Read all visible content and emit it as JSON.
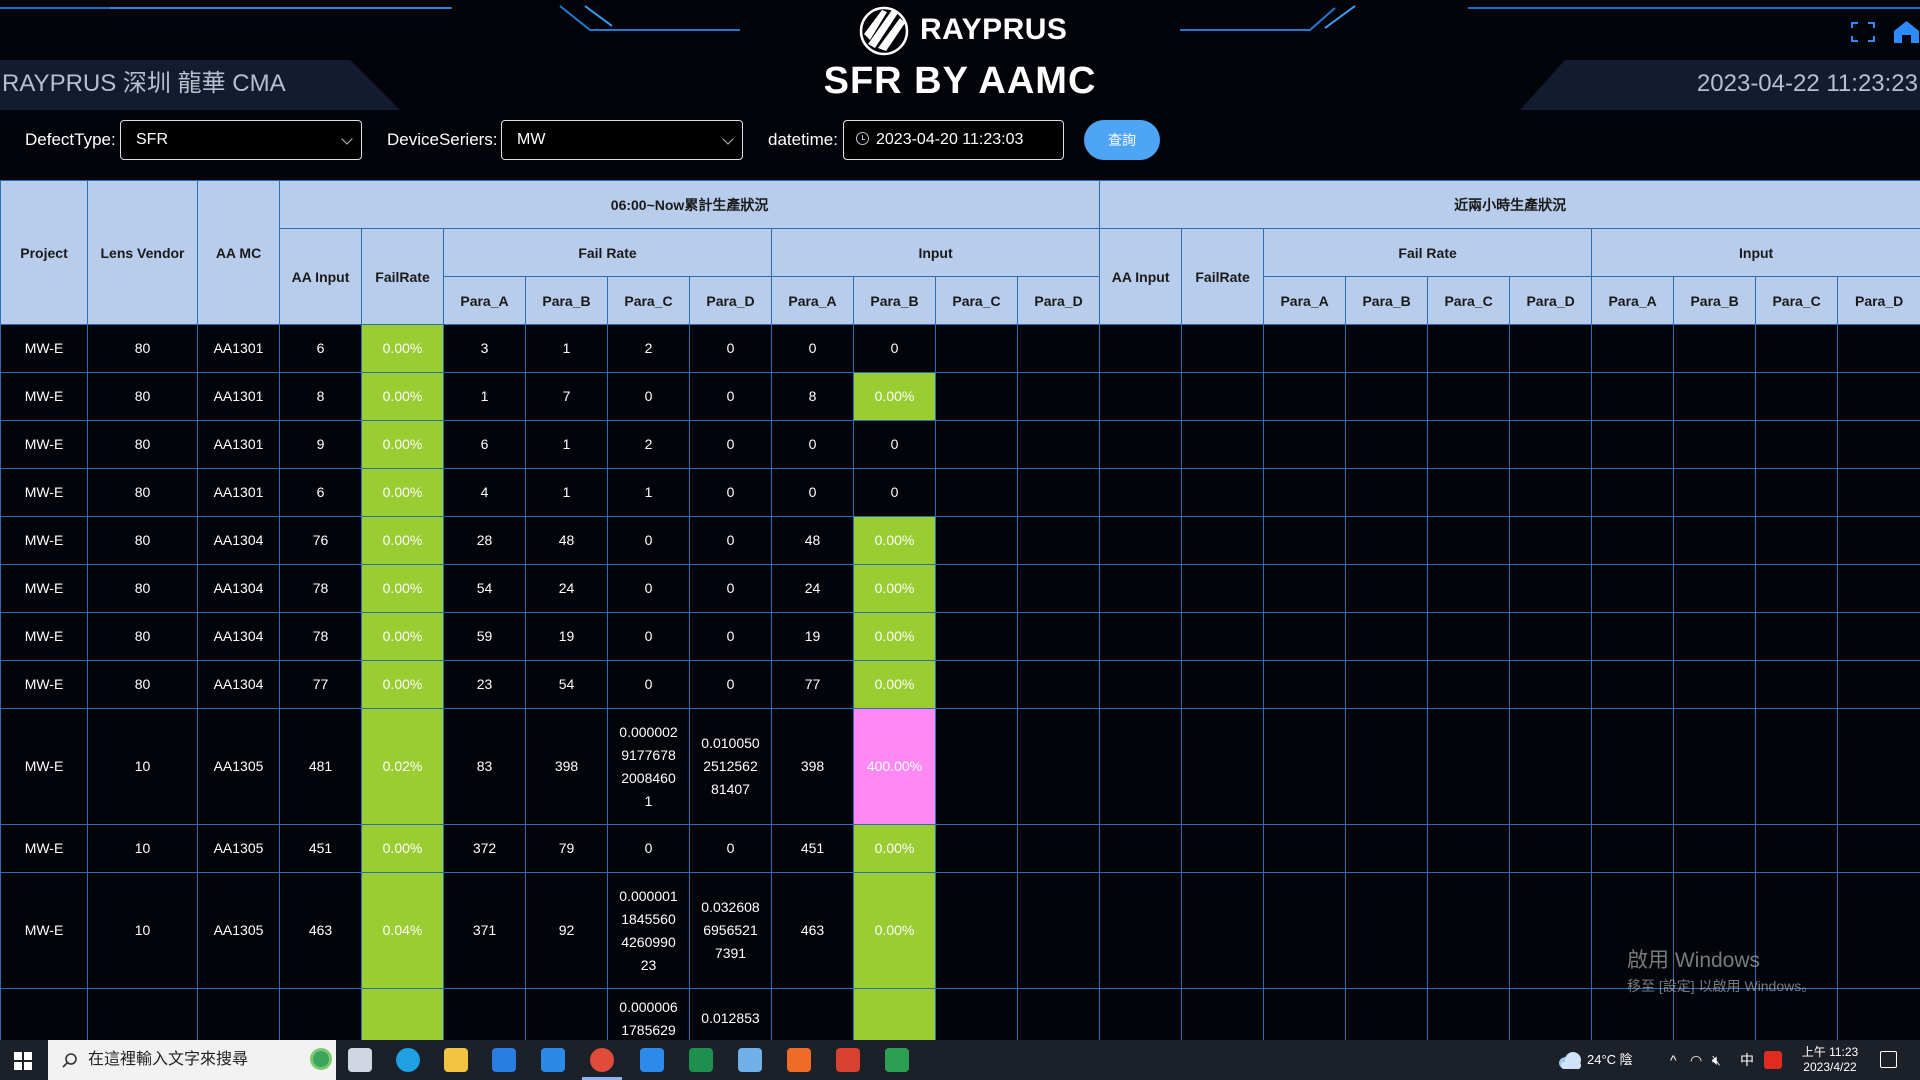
{
  "header": {
    "logo_text": "RAYPRUS",
    "title": "SFR BY AAMC",
    "site_label": "RAYPRUS 深圳 龍華 CMA",
    "datetime": "2023-04-22 11:23:23"
  },
  "filters": {
    "defect_type_label": "DefectType:",
    "defect_type_value": "SFR",
    "device_series_label": "DeviceSeriers:",
    "device_series_value": "MW",
    "datetime_label": "datetime:",
    "datetime_value": "2023-04-20 11:23:03",
    "query_label": "查詢"
  },
  "table": {
    "headers": {
      "project": "Project",
      "lens_vendor": "Lens Vendor",
      "aa_mc": "AA MC",
      "group_now": "06:00~Now累計生產狀況",
      "group_recent": "近兩小時生產狀況",
      "aa_input": "AA Input",
      "fail_rate": "FailRate",
      "fail_rate_group": "Fail Rate",
      "input_group": "Input",
      "para_a": "Para_A",
      "para_b": "Para_B",
      "para_c": "Para_C",
      "para_d": "Para_D"
    },
    "rows": [
      {
        "project": "MW-E",
        "vendor": "80",
        "mc": "AA1301",
        "aa_input": "6",
        "fail_rate": "0.00%",
        "fa": "3",
        "fb": "1",
        "fc": "2",
        "fd": "0",
        "ia": "0",
        "ib": "0",
        "ib_color": "none"
      },
      {
        "project": "MW-E",
        "vendor": "80",
        "mc": "AA1301",
        "aa_input": "8",
        "fail_rate": "0.00%",
        "fa": "1",
        "fb": "7",
        "fc": "0",
        "fd": "0",
        "ia": "8",
        "ib": "0.00%",
        "ib_color": "green"
      },
      {
        "project": "MW-E",
        "vendor": "80",
        "mc": "AA1301",
        "aa_input": "9",
        "fail_rate": "0.00%",
        "fa": "6",
        "fb": "1",
        "fc": "2",
        "fd": "0",
        "ia": "0",
        "ib": "0",
        "ib_color": "none"
      },
      {
        "project": "MW-E",
        "vendor": "80",
        "mc": "AA1301",
        "aa_input": "6",
        "fail_rate": "0.00%",
        "fa": "4",
        "fb": "1",
        "fc": "1",
        "fd": "0",
        "ia": "0",
        "ib": "0",
        "ib_color": "none"
      },
      {
        "project": "MW-E",
        "vendor": "80",
        "mc": "AA1304",
        "aa_input": "76",
        "fail_rate": "0.00%",
        "fa": "28",
        "fb": "48",
        "fc": "0",
        "fd": "0",
        "ia": "48",
        "ib": "0.00%",
        "ib_color": "green"
      },
      {
        "project": "MW-E",
        "vendor": "80",
        "mc": "AA1304",
        "aa_input": "78",
        "fail_rate": "0.00%",
        "fa": "54",
        "fb": "24",
        "fc": "0",
        "fd": "0",
        "ia": "24",
        "ib": "0.00%",
        "ib_color": "green"
      },
      {
        "project": "MW-E",
        "vendor": "80",
        "mc": "AA1304",
        "aa_input": "78",
        "fail_rate": "0.00%",
        "fa": "59",
        "fb": "19",
        "fc": "0",
        "fd": "0",
        "ia": "19",
        "ib": "0.00%",
        "ib_color": "green"
      },
      {
        "project": "MW-E",
        "vendor": "80",
        "mc": "AA1304",
        "aa_input": "77",
        "fail_rate": "0.00%",
        "fa": "23",
        "fb": "54",
        "fc": "0",
        "fd": "0",
        "ia": "77",
        "ib": "0.00%",
        "ib_color": "green"
      },
      {
        "project": "MW-E",
        "vendor": "10",
        "mc": "AA1305",
        "aa_input": "481",
        "fail_rate": "0.02%",
        "fa": "83",
        "fb": "398",
        "fc": "0.000002\n9177678\n2008460\n1",
        "fd": "0.010050\n2512562\n81407",
        "ia": "398",
        "ib": "400.00%",
        "ib_color": "pink"
      },
      {
        "project": "MW-E",
        "vendor": "10",
        "mc": "AA1305",
        "aa_input": "451",
        "fail_rate": "0.00%",
        "fa": "372",
        "fb": "79",
        "fc": "0",
        "fd": "0",
        "ia": "451",
        "ib": "0.00%",
        "ib_color": "green"
      },
      {
        "project": "MW-E",
        "vendor": "10",
        "mc": "AA1305",
        "aa_input": "463",
        "fail_rate": "0.04%",
        "fa": "371",
        "fb": "92",
        "fc": "0.000001\n1845560\n4260990\n23",
        "fd": "0.032608\n6956521\n7391",
        "ia": "463",
        "ib": "0.00%",
        "ib_color": "green"
      },
      {
        "project": "",
        "vendor": "",
        "mc": "",
        "aa_input": "",
        "fail_rate": "",
        "fa": "",
        "fb": "",
        "fc": "0.000006\n1785629",
        "fd": "0.012853",
        "ia": "",
        "ib": "",
        "ib_color": "green"
      }
    ]
  },
  "watermark": {
    "line1": "啟用 Windows",
    "line2": "移至 [設定] 以啟用 Windows。"
  },
  "taskbar": {
    "search_placeholder": "在這裡輸入文字來搜尋",
    "weather": "24°C 陰",
    "ime": "中",
    "time": "上午 11:23",
    "date": "2023/4/22",
    "icons": [
      "task-view-icon",
      "edge-icon",
      "file-explorer-icon",
      "store-icon",
      "mail-icon",
      "chrome-icon",
      "vscode-icon",
      "excel-icon",
      "notepad-icon",
      "app-orange-icon",
      "app-red-icon",
      "app-green-icon"
    ]
  },
  "colors": {
    "header_cell": "#b8cceb",
    "grid_line": "#2b6fb3",
    "ok_green": "#9acd32",
    "alert_pink": "#ff88f5",
    "query_button": "#4ea4f5"
  }
}
